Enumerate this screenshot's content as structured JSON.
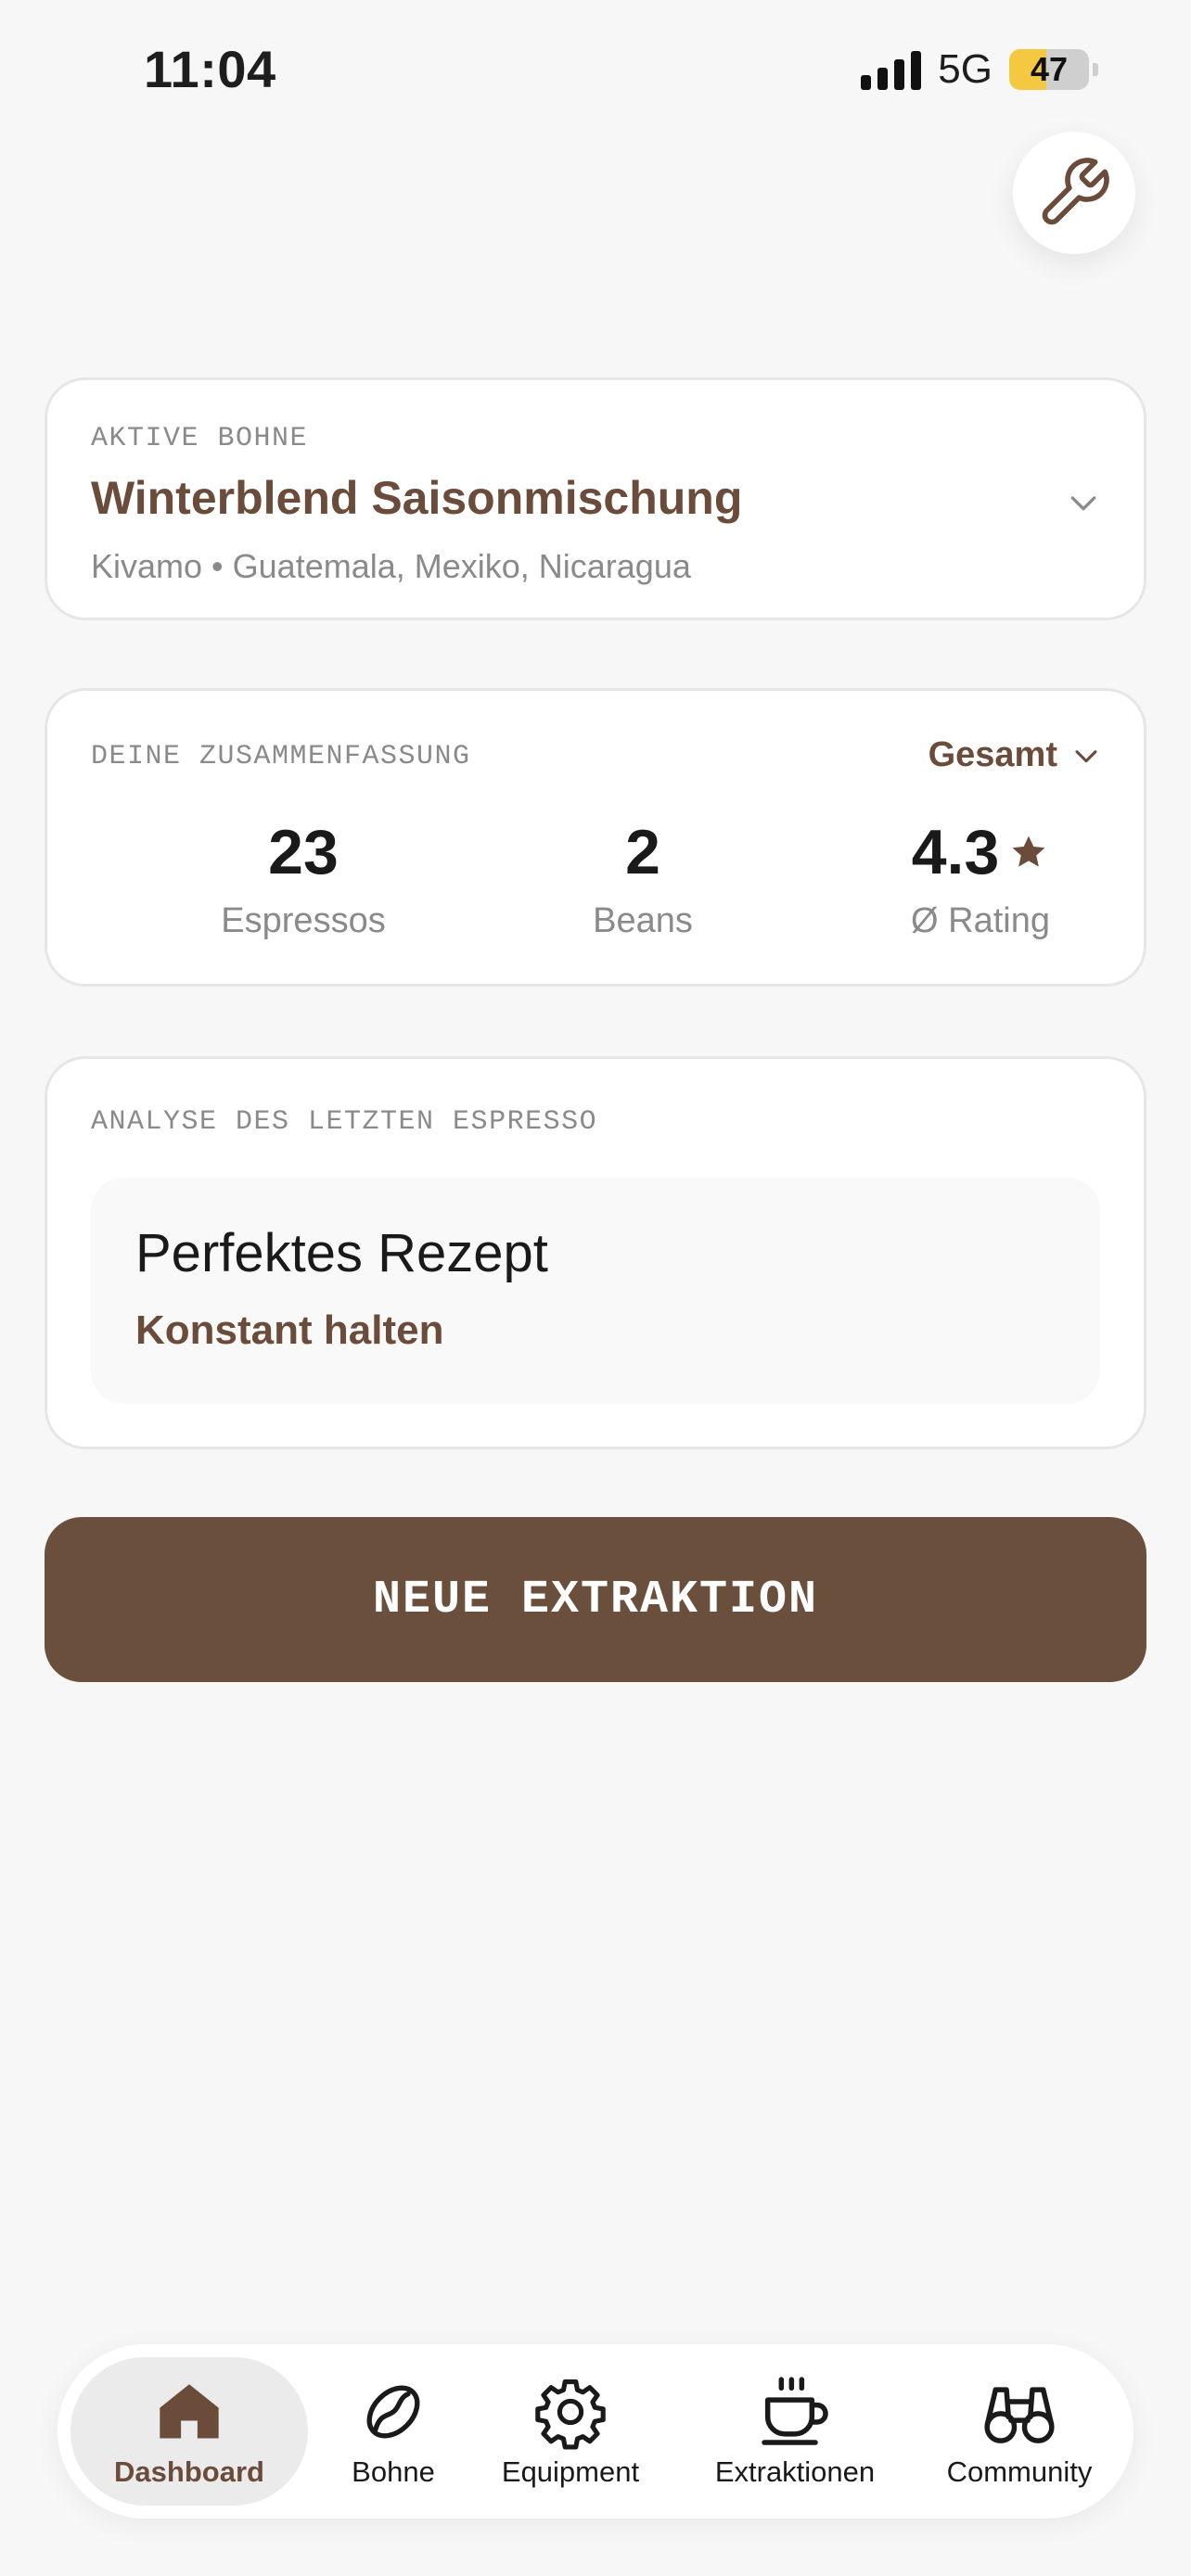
{
  "status_bar": {
    "time": "11:04",
    "network": "5G",
    "battery": "47",
    "battery_level": 0.47
  },
  "icons": {
    "tools": "wrench-icon",
    "chevron": "chevron-down-icon",
    "star": "star-icon"
  },
  "colors": {
    "accent": "#6b4c3b",
    "button": "#6b4f3d",
    "battery": "#f5c842"
  },
  "bean_card": {
    "eyebrow": "AKTIVE BOHNE",
    "name": "Winterblend Saisonmischung",
    "origin": "Kivamo • Guatemala, Mexiko, Nicaragua"
  },
  "summary": {
    "eyebrow": "DEINE ZUSAMMENFASSUNG",
    "period": "Gesamt",
    "stats": [
      {
        "value": "23",
        "label": "Espressos"
      },
      {
        "value": "2",
        "label": "Beans"
      },
      {
        "value": "4.3",
        "label": "Ø Rating"
      }
    ]
  },
  "analysis": {
    "eyebrow": "ANALYSE DES LETZTEN ESPRESSO",
    "title": "Perfektes Rezept",
    "subtitle": "Konstant halten"
  },
  "cta_label": "NEUE EXTRAKTION",
  "tabs": [
    {
      "label": "Dashboard",
      "icon": "house-icon",
      "active": true
    },
    {
      "label": "Bohne",
      "icon": "coffee-bean-icon",
      "active": false
    },
    {
      "label": "Equipment",
      "icon": "gear-icon",
      "active": false
    },
    {
      "label": "Extraktionen",
      "icon": "coffee-cup-icon",
      "active": false
    },
    {
      "label": "Community",
      "icon": "binoculars-icon",
      "active": false
    }
  ]
}
